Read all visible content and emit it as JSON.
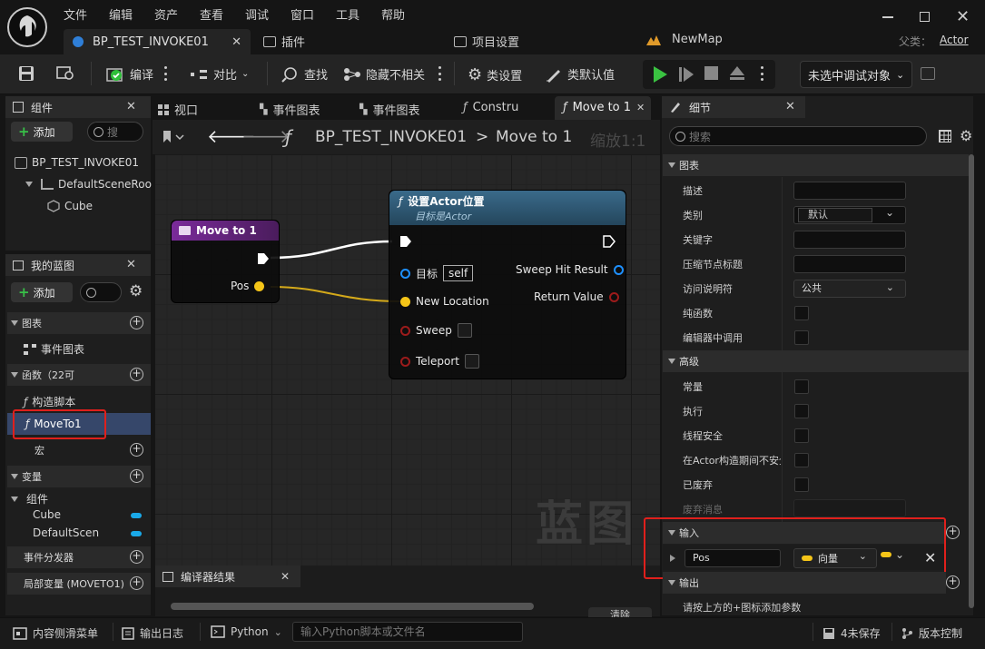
{
  "menu": [
    "文件",
    "编辑",
    "资产",
    "查看",
    "调试",
    "窗口",
    "工具",
    "帮助"
  ],
  "tabs": {
    "asset_tab": "BP_TEST_INVOKE01",
    "plugins": "插件",
    "project_settings": "项目设置",
    "map": "NewMap",
    "parent_label": "父类：",
    "parent_value": "Actor"
  },
  "toolbar": {
    "compile": "编译",
    "diff": "对比",
    "find": "查找",
    "hide_unrelated": "隐藏不相关",
    "class_settings": "类设置",
    "class_defaults": "类默认值",
    "debug_target": "未选中调试对象"
  },
  "components": {
    "title": "组件",
    "add": "添加",
    "search_placeholder": "搜",
    "items": [
      "BP_TEST_INVOKE01",
      "DefaultSceneRoo",
      "Cube"
    ]
  },
  "my_blueprint": {
    "title": "我的蓝图",
    "add": "添加",
    "graphs_header": "图表",
    "event_graph": "事件图表",
    "functions_header": "函数（22可",
    "construct": "构造脚本",
    "function_item": "MoveTo1",
    "macros_header": "宏",
    "variables_header": "变量",
    "components_group": "组件",
    "var_cube": "Cube",
    "var_root": "DefaultScen",
    "dispatchers_header": "事件分发器",
    "local_vars_header": "局部变量 (MOVETO1)"
  },
  "editor_tabs": [
    "视口",
    "事件图表",
    "事件图表",
    "Constru",
    "Move to 1"
  ],
  "graph": {
    "breadcrumb_bp": "BP_TEST_INVOKE01",
    "breadcrumb_sep": ">",
    "breadcrumb_fn": "Move to 1",
    "zoom": "缩放1:1",
    "watermark": "蓝图",
    "entry_node": {
      "title": "Move to 1",
      "pin": "Pos"
    },
    "set_node": {
      "title": "设置Actor位置",
      "subtitle": "目标是Actor",
      "target_label": "目标",
      "target_value": "self",
      "new_location": "New Location",
      "sweep": "Sweep",
      "teleport": "Teleport",
      "sweep_hit": "Sweep Hit Result",
      "return_value": "Return Value"
    },
    "colors": {
      "exec": "#ffffff",
      "vector": "#f5c518",
      "struct": "#1e90ff",
      "bool": "#9c1b1b"
    }
  },
  "compiler": {
    "title": "编译器结果",
    "clear": "清除"
  },
  "details": {
    "title": "细节",
    "search_placeholder": "搜索",
    "graph_section": "图表",
    "desc": "描述",
    "category": "类别",
    "category_value": "默认",
    "keywords": "关键字",
    "compact_title": "压缩节点标题",
    "access": "访问说明符",
    "access_value": "公共",
    "pure": "纯函数",
    "call_in_editor": "编辑器中调用",
    "advanced_section": "高级",
    "const": "常量",
    "exec": "执行",
    "thread_safe": "线程安全",
    "unsafe_construct": "在Actor构造期间不安全",
    "deprecated": "已废弃",
    "deprecation_msg": "废弃消息",
    "inputs_section": "输入",
    "input_name": "Pos",
    "input_type": "向量",
    "outputs_section": "输出",
    "outputs_hint": "请按上方的+图标添加参数"
  },
  "statusbar": {
    "content_drawer": "内容侧滑菜单",
    "output_log": "输出日志",
    "cmd": "Python",
    "cmd_placeholder": "输入Python脚本或文件名",
    "unsaved": "4未保存",
    "source_control": "版本控制"
  }
}
